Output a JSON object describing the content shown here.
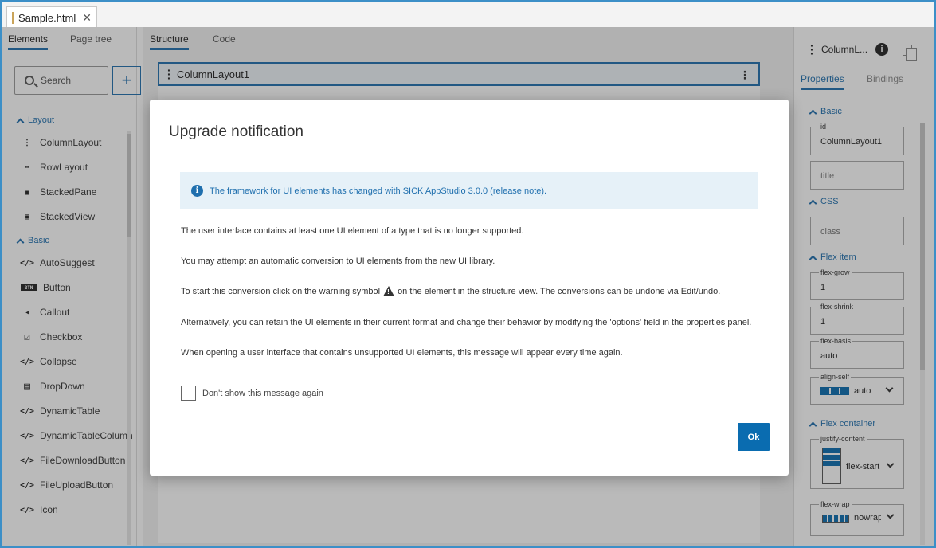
{
  "file_tab": {
    "label": "Sample.html",
    "close": "✕"
  },
  "left_panel": {
    "tabs": [
      "Elements",
      "Page tree"
    ],
    "search": {
      "placeholder": "Search"
    },
    "add_label": "+",
    "sections": [
      {
        "title": "Layout",
        "items": [
          {
            "label": "ColumnLayout",
            "icon": "column-layout-icon",
            "glyph": "⋮"
          },
          {
            "label": "RowLayout",
            "icon": "row-layout-icon",
            "glyph": "⋯"
          },
          {
            "label": "StackedPane",
            "icon": "stacked-pane-icon",
            "glyph": "▣"
          },
          {
            "label": "StackedView",
            "icon": "stacked-view-icon",
            "glyph": "▣"
          }
        ]
      },
      {
        "title": "Basic",
        "items": [
          {
            "label": "AutoSuggest",
            "icon": "code-icon",
            "glyph": "</>"
          },
          {
            "label": "Button",
            "icon": "button-icon",
            "glyph": "BTN"
          },
          {
            "label": "Callout",
            "icon": "callout-icon",
            "glyph": "◂"
          },
          {
            "label": "Checkbox",
            "icon": "checkbox-icon",
            "glyph": "☑"
          },
          {
            "label": "Collapse",
            "icon": "code-icon",
            "glyph": "</>"
          },
          {
            "label": "DropDown",
            "icon": "dropdown-icon",
            "glyph": "▤"
          },
          {
            "label": "DynamicTable",
            "icon": "code-icon",
            "glyph": "</>"
          },
          {
            "label": "DynamicTableColumn",
            "icon": "code-icon",
            "glyph": "</>"
          },
          {
            "label": "FileDownloadButton",
            "icon": "code-icon",
            "glyph": "</>"
          },
          {
            "label": "FileUploadButton",
            "icon": "code-icon",
            "glyph": "</>"
          },
          {
            "label": "Icon",
            "icon": "code-icon",
            "glyph": "</>"
          }
        ]
      }
    ]
  },
  "middle": {
    "tabs": [
      "Structure",
      "Code"
    ],
    "column_layout": "ColumnLayout1"
  },
  "right_panel": {
    "title": "ColumnL...",
    "tabs": [
      "Properties",
      "Bindings"
    ],
    "sections": {
      "basic": "Basic",
      "css": "CSS",
      "flex_item": "Flex item",
      "flex_container": "Flex container"
    },
    "fields": {
      "id": {
        "label": "id",
        "value": "ColumnLayout1"
      },
      "title": {
        "placeholder": "title"
      },
      "class": {
        "placeholder": "class"
      },
      "flex_grow": {
        "label": "flex-grow",
        "value": "1"
      },
      "flex_shrink": {
        "label": "flex-shrink",
        "value": "1"
      },
      "flex_basis": {
        "label": "flex-basis",
        "value": "auto"
      },
      "align_self": {
        "label": "align-self",
        "value": "auto"
      },
      "justify_content": {
        "label": "justify-content",
        "value": "flex-start"
      },
      "flex_wrap": {
        "label": "flex-wrap",
        "value": "nowrap"
      }
    }
  },
  "dialog": {
    "title": "Upgrade notification",
    "banner": "The framework for UI elements has changed with SICK AppStudio 3.0.0 (release note).",
    "p1": "The user interface contains at least one UI element of a type that is no longer supported.",
    "p2": "You may attempt an automatic conversion to UI elements from the new UI library.",
    "p3_before": "To start this conversion click on the warning symbol",
    "p3_after": "on the element in the structure view. The conversions can be undone via Edit/undo.",
    "p4": "Alternatively, you can retain the UI elements in their current format and change their behavior by modifying the 'options' field in the properties panel.",
    "p5": "When opening a user interface that contains unsupported UI elements, this message will appear every time again.",
    "checkbox_label": "Don't show this message again",
    "ok_label": "Ok"
  }
}
